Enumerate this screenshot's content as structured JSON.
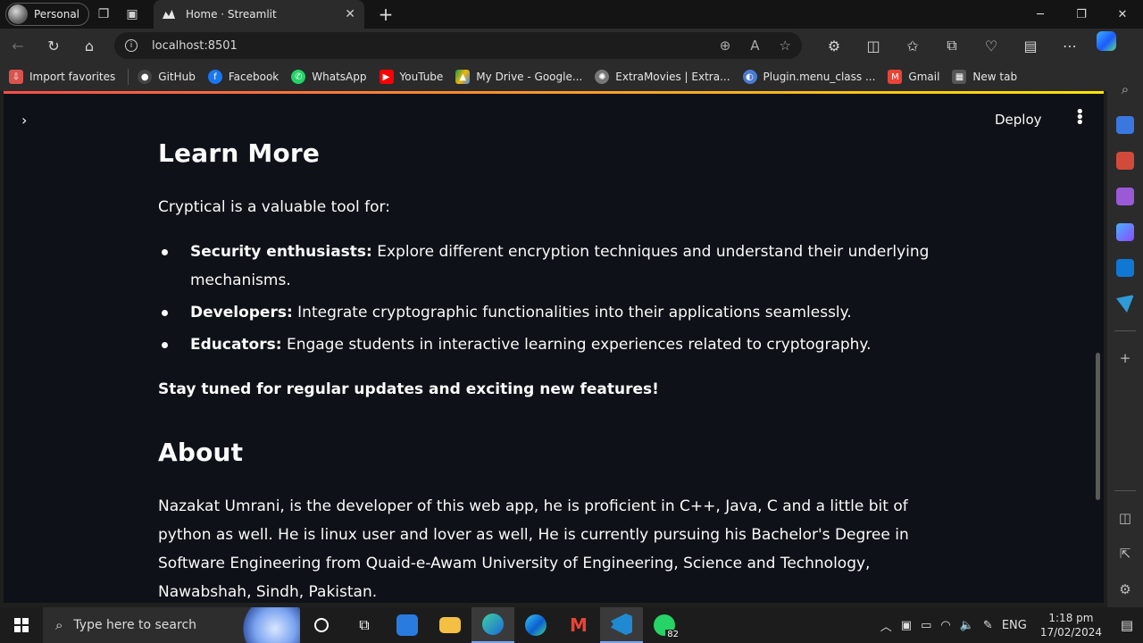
{
  "browser": {
    "profile_label": "Personal",
    "tab_title": "Home · Streamlit",
    "url": "localhost:8501",
    "bookmarks": [
      {
        "label": "Import favorites",
        "icon": "import-icon",
        "color": "#d9534f"
      },
      {
        "label": "GitHub",
        "icon": "github-icon",
        "color": "#333333"
      },
      {
        "label": "Facebook",
        "icon": "facebook-icon",
        "color": "#1877f2"
      },
      {
        "label": "WhatsApp",
        "icon": "whatsapp-icon",
        "color": "#25d366"
      },
      {
        "label": "YouTube",
        "icon": "youtube-icon",
        "color": "#ff0000"
      },
      {
        "label": "My Drive - Google...",
        "icon": "drive-icon",
        "color": "#f4b400"
      },
      {
        "label": "ExtraMovies | Extra...",
        "icon": "film-icon",
        "color": "#777777"
      },
      {
        "label": "Plugin.menu_class ...",
        "icon": "plugin-icon",
        "color": "#4a7bd0"
      },
      {
        "label": "Gmail",
        "icon": "gmail-icon",
        "color": "#ea4335"
      },
      {
        "label": "New tab",
        "icon": "newtab-icon",
        "color": "#666666"
      }
    ]
  },
  "app": {
    "deploy_label": "Deploy",
    "learn_more": {
      "heading": "Learn More",
      "intro": "Cryptical is a valuable tool for:",
      "items": [
        {
          "bold": "Security enthusiasts:",
          "text": " Explore different encryption techniques and understand their underlying mechanisms."
        },
        {
          "bold": "Developers:",
          "text": " Integrate cryptographic functionalities into their applications seamlessly."
        },
        {
          "bold": "Educators:",
          "text": " Engage students in interactive learning experiences related to cryptography."
        }
      ],
      "closing": "Stay tuned for regular updates and exciting new features!"
    },
    "about": {
      "heading": "About",
      "body": "Nazakat Umrani, is the developer of this web app, he is proficient in C++, Java, C and a little bit of python as well. He is linux user and lover as well, He is currently pursuing his Bachelor's Degree in Software Engineering from Quaid-e-Awam University of Engineering, Science and Technology, Nawabshah, Sindh, Pakistan."
    }
  },
  "taskbar": {
    "search_placeholder": "Type here to search",
    "whatsapp_badge": "82",
    "language": "ENG",
    "time": "1:18 pm",
    "date": "17/02/2024"
  },
  "colors": {
    "page_bg": "#0e1117",
    "header_gradient_start": "#ff4b4b",
    "header_gradient_end": "#ffe600"
  }
}
